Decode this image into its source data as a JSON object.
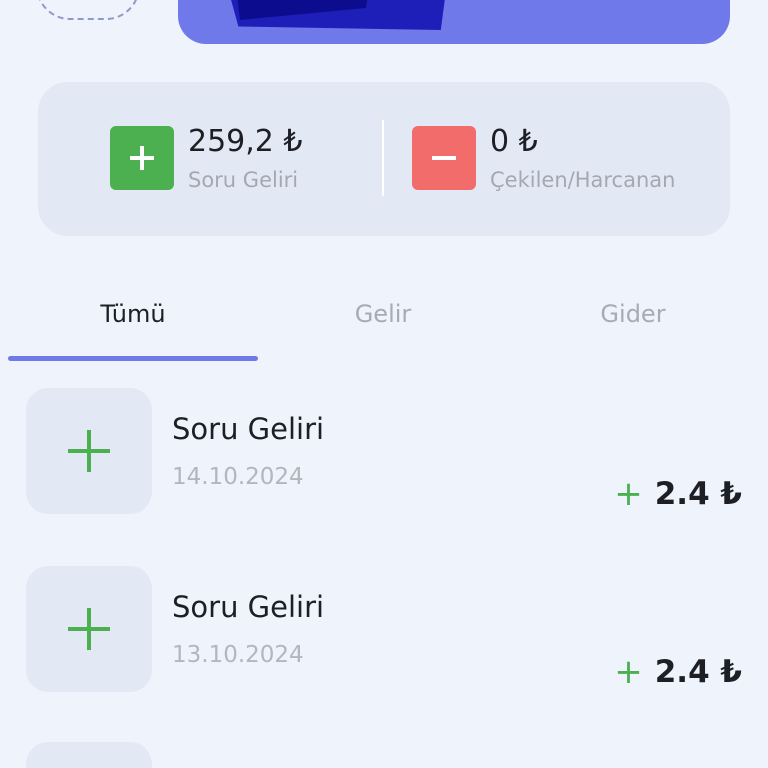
{
  "summary": {
    "income": {
      "amount": "259,2 ₺",
      "label": "Soru Geliri",
      "icon": "plus-icon"
    },
    "expense": {
      "amount": "0 ₺",
      "label": "Çekilen/Harcanan",
      "icon": "minus-icon"
    }
  },
  "tabs": [
    {
      "label": "Tümü",
      "active": true
    },
    {
      "label": "Gelir",
      "active": false
    },
    {
      "label": "Gider",
      "active": false
    }
  ],
  "transactions": [
    {
      "title": "Soru Geliri",
      "date": "14.10.2024",
      "sign": "+",
      "amount": "2.4 ₺",
      "icon": "plus-icon"
    },
    {
      "title": "Soru Geliri",
      "date": "13.10.2024",
      "sign": "+",
      "amount": "2.4 ₺",
      "icon": "plus-icon"
    }
  ],
  "colors": {
    "accent": "#6f79ea",
    "income": "#4cb050",
    "expense": "#f26c6c",
    "background": "#eef3fc",
    "card": "#e3e9f4"
  }
}
